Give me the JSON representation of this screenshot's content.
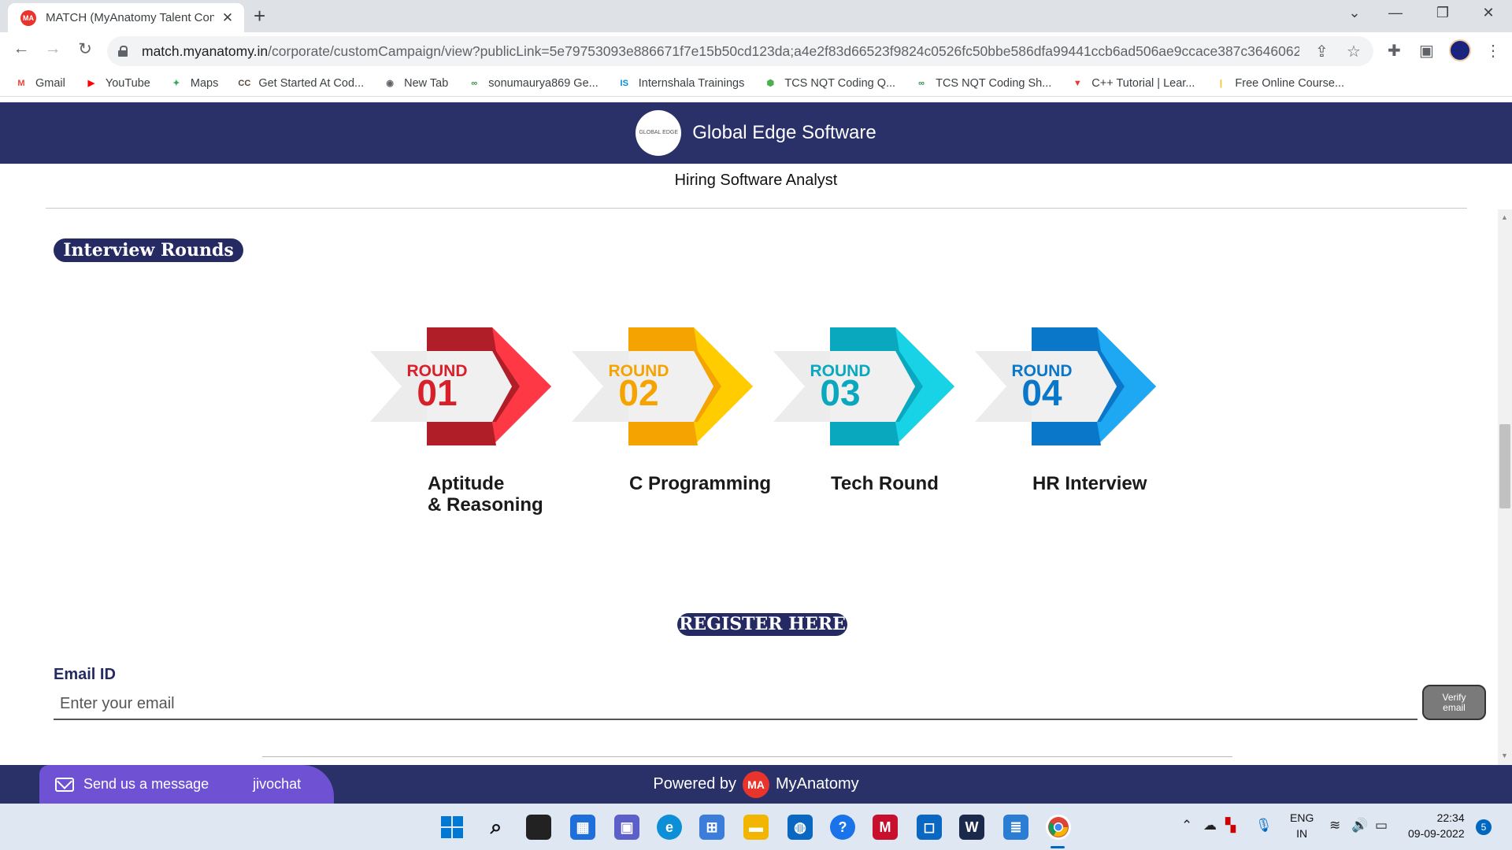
{
  "browser": {
    "tab_title": "MATCH (MyAnatomy Talent Conv",
    "url_host": "match.myanatomy.in",
    "url_path": "/corporate/customCampaign/view?publicLink=5e79753093e886671f7e15b50cd123da;a4e2f83d66523f9824c0526fc50bbe586dfa99441ccb6ad506ae9ccace387c36460623...",
    "bookmarks": [
      {
        "label": "Gmail",
        "icon": "gmail-icon",
        "glyph": "M",
        "color": "#ea4335"
      },
      {
        "label": "YouTube",
        "icon": "youtube-icon",
        "glyph": "▶",
        "color": "#ff0000"
      },
      {
        "label": "Maps",
        "icon": "maps-icon",
        "glyph": "✦",
        "color": "#34a853"
      },
      {
        "label": "Get Started At Cod...",
        "icon": "codechef-icon",
        "glyph": "CC",
        "color": "#5b4636"
      },
      {
        "label": "New Tab",
        "icon": "globe-icon",
        "glyph": "◉",
        "color": "#5f6368"
      },
      {
        "label": "sonumaurya869 Ge...",
        "icon": "gfg-icon",
        "glyph": "∞",
        "color": "#2f8d46"
      },
      {
        "label": "Internshala Trainings",
        "icon": "internshala-icon",
        "glyph": "IS",
        "color": "#008bdc"
      },
      {
        "label": "TCS NQT Coding Q...",
        "icon": "shield-green-icon",
        "glyph": "⬢",
        "color": "#4caf50"
      },
      {
        "label": "TCS NQT Coding Sh...",
        "icon": "gfg-icon",
        "glyph": "∞",
        "color": "#2f8d46"
      },
      {
        "label": "C++ Tutorial | Lear...",
        "icon": "tutorial-icon",
        "glyph": "▼",
        "color": "#e53935"
      },
      {
        "label": "Free Online Course...",
        "icon": "course-icon",
        "glyph": "|",
        "color": "#fbbc05"
      }
    ]
  },
  "header": {
    "company": "Global Edge Software",
    "logo_text": "GLOBAL EDGE",
    "hiring": "Hiring Software Analyst"
  },
  "interview": {
    "title": "Interview Rounds",
    "round_word": "ROUND",
    "rounds": [
      {
        "number": "01",
        "name_line1": "Aptitude",
        "name_line2": "& Reasoning",
        "color_light": "#ff3845",
        "color_dark": "#b01f27"
      },
      {
        "number": "02",
        "name_line1": "C Programming",
        "name_line2": "",
        "color_light": "#ffcc00",
        "color_dark": "#f5a300"
      },
      {
        "number": "03",
        "name_line1": "Tech Round",
        "name_line2": "",
        "color_light": "#18d2e6",
        "color_dark": "#0aa8bf"
      },
      {
        "number": "04",
        "name_line1": "HR Interview",
        "name_line2": "",
        "color_light": "#1ea7f2",
        "color_dark": "#0a77c8"
      }
    ]
  },
  "register": {
    "title": "REGISTER HERE",
    "email_label": "Email ID",
    "email_placeholder": "Enter your email",
    "verify_label": "Verify email"
  },
  "footer": {
    "powered_by": "Powered by",
    "brand": "MyAnatomy",
    "brand_logo": "MA",
    "chat_label": "Send us a message",
    "chat_brand": "jivochat"
  },
  "taskbar": {
    "lang_line1": "ENG",
    "lang_line2": "IN",
    "time": "22:34",
    "date": "09-09-2022",
    "notifications": "5"
  },
  "colors": {
    "brand_navy": "#2a3168",
    "pill_navy": "#252a62",
    "chat_purple": "#6f52d4"
  }
}
